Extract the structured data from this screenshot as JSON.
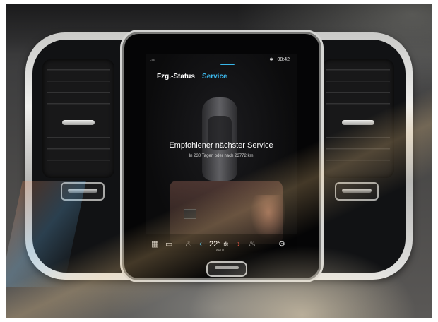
{
  "status_bar": {
    "network": "LTE",
    "bluetooth": "✱",
    "clock": "08:42"
  },
  "tabs": [
    {
      "label": "Fzg.-Status",
      "active": false
    },
    {
      "label": "Service",
      "active": true
    }
  ],
  "service": {
    "heading": "Empfohlener nächster Service",
    "detail": "In 230 Tagen oder nach 23772 km"
  },
  "climate_bar": {
    "temperature": "22°",
    "temperature_mode": "AUTO",
    "icons": [
      "home-grid-icon",
      "camera-icon",
      "seat-heat-icon",
      "chevron-left-icon",
      "fan-icon",
      "chevron-right-icon",
      "seat-heat-right-icon",
      "settings-icon"
    ]
  },
  "colors": {
    "accent": "#3cb8ec",
    "warning": "#e24a3b",
    "screen_bg": "#0b0b0c"
  }
}
